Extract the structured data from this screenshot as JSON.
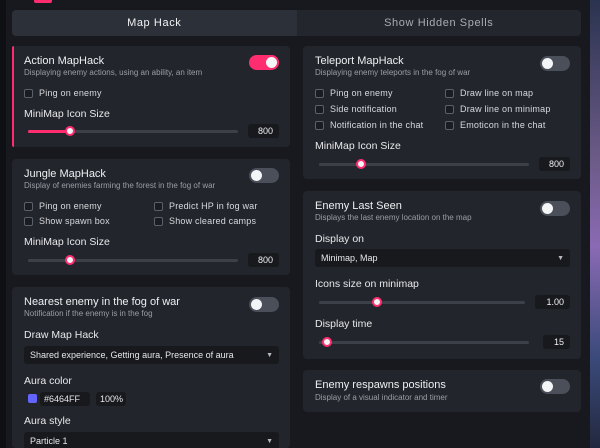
{
  "tabs": [
    {
      "label": "Map Hack",
      "active": true
    },
    {
      "label": "Show Hidden Spells",
      "active": false
    }
  ],
  "accent_color": "#FF2D6F",
  "action_maphack": {
    "title": "Action MapHack",
    "subtitle": "Displaying enemy actions, using an ability, an item",
    "enabled": true,
    "ping_on_enemy": "Ping on enemy",
    "icon_size_label": "MiniMap Icon Size",
    "icon_size_value": "800",
    "icon_size_fraction": 0.2
  },
  "jungle_maphack": {
    "title": "Jungle MapHack",
    "subtitle": "Display of enemies farming the forest in the fog of war",
    "enabled": false,
    "options": [
      "Ping on enemy",
      "Predict HP in fog war",
      "Show spawn box",
      "Show cleared camps"
    ],
    "icon_size_label": "MiniMap Icon Size",
    "icon_size_value": "800",
    "icon_size_fraction": 0.2
  },
  "nearest_enemy": {
    "title": "Nearest enemy in the fog of war",
    "subtitle": "Notification if the enemy is in the fog",
    "enabled": false,
    "draw_label": "Draw Map Hack",
    "draw_value": "Shared experience, Getting aura, Presence of aura",
    "aura_color_label": "Aura color",
    "aura_color_hex": "#6464FF",
    "aura_opacity": "100%",
    "aura_style_label": "Aura style",
    "aura_style_value": "Particle 1"
  },
  "teleport_maphack": {
    "title": "Teleport MapHack",
    "subtitle": "Displaying enemy teleports in the fog of war",
    "enabled": false,
    "options": [
      "Ping on enemy",
      "Draw line on map",
      "Side notification",
      "Draw line on minimap",
      "Notification in the chat",
      "Emoticon in the chat"
    ],
    "icon_size_label": "MiniMap Icon Size",
    "icon_size_value": "800",
    "icon_size_fraction": 0.2
  },
  "enemy_last_seen": {
    "title": "Enemy Last Seen",
    "subtitle": "Displays the last enemy location on the map",
    "enabled": false,
    "display_on_label": "Display on",
    "display_on_value": "Minimap, Map",
    "icons_size_label": "Icons size on minimap",
    "icons_size_value": "1.00",
    "icons_size_fraction": 0.28,
    "display_time_label": "Display time",
    "display_time_value": "15",
    "display_time_fraction": 0.04
  },
  "enemy_respawns": {
    "title": "Enemy respawns positions",
    "subtitle": "Display of a visual indicator and timer",
    "enabled": false
  }
}
